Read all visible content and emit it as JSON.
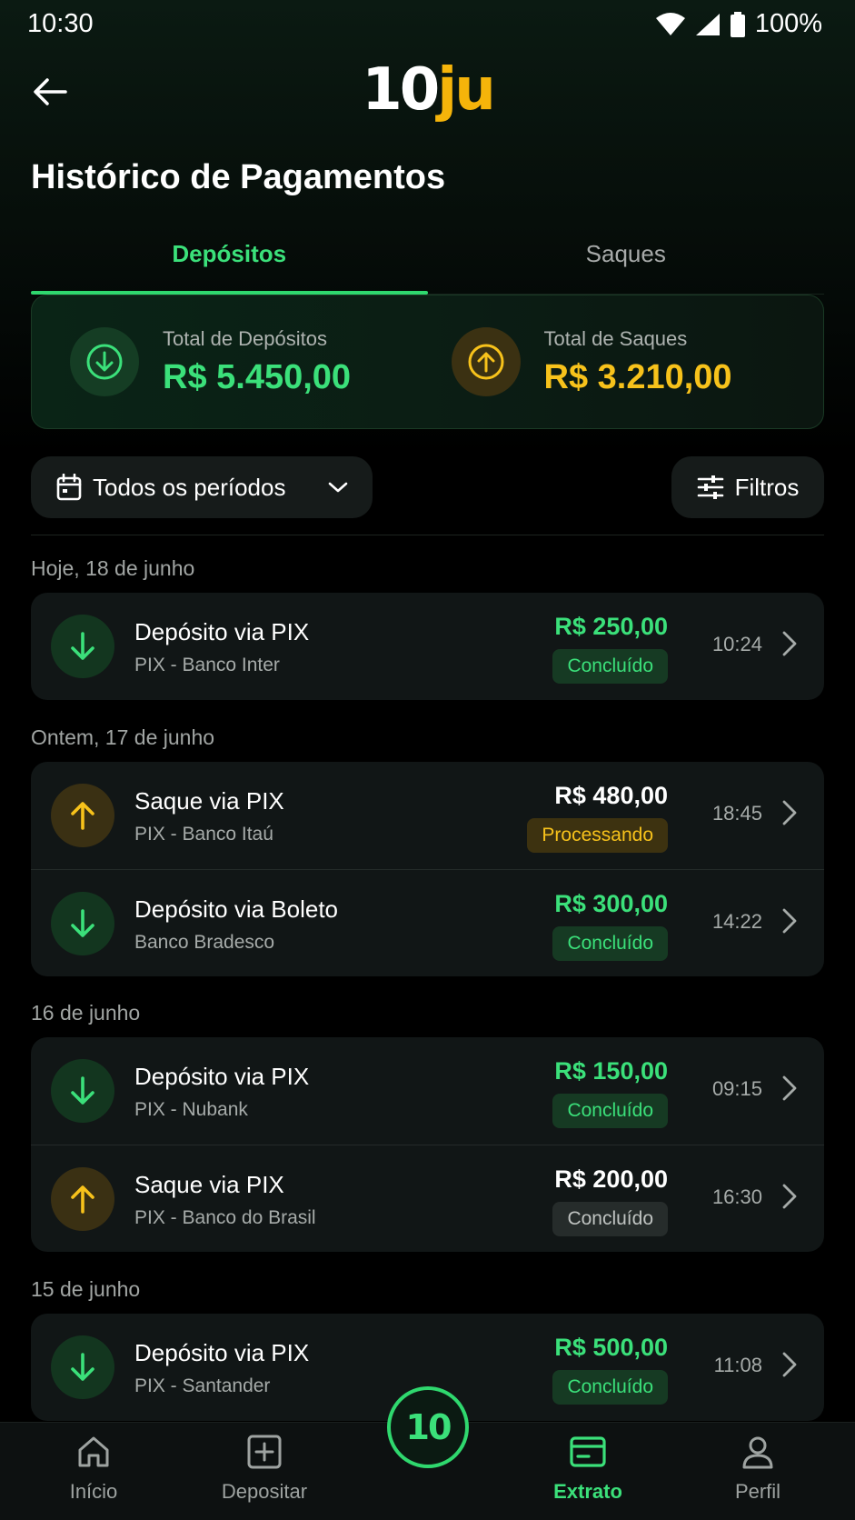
{
  "status_bar": {
    "time": "10:30",
    "battery": "100%"
  },
  "header": {
    "logo_main": "10",
    "logo_accent": "ju"
  },
  "page_title": "Histórico de Pagamentos",
  "tabs": [
    {
      "label": "Depósitos",
      "active": true
    },
    {
      "label": "Saques",
      "active": false
    }
  ],
  "summary": {
    "deposits": {
      "label": "Total de Depósitos",
      "value": "R$ 5.450,00"
    },
    "withdrawals": {
      "label": "Total de Saques",
      "value": "R$ 3.210,00"
    }
  },
  "filters": {
    "period": "Todos os períodos",
    "filters_label": "Filtros"
  },
  "groups": [
    {
      "label": "Hoje, 18 de junho",
      "items": [
        {
          "title": "Depósito via PIX",
          "subtitle": "PIX - Banco Inter",
          "amount": "R$ 250,00",
          "status": "Concluído",
          "time": "10:24",
          "kind": "deposit",
          "status_color": "green"
        }
      ]
    },
    {
      "label": "Ontem, 17 de junho",
      "items": [
        {
          "title": "Saque via PIX",
          "subtitle": "PIX - Banco Itaú",
          "amount": "R$ 480,00",
          "status": "Processando",
          "time": "18:45",
          "kind": "withdrawal",
          "status_color": "yellow"
        },
        {
          "title": "Depósito via Boleto",
          "subtitle": "Banco Bradesco",
          "amount": "R$ 300,00",
          "status": "Concluído",
          "time": "14:22",
          "kind": "deposit",
          "status_color": "green"
        }
      ]
    },
    {
      "label": "16 de junho",
      "items": [
        {
          "title": "Depósito via PIX",
          "subtitle": "PIX - Nubank",
          "amount": "R$ 150,00",
          "status": "Concluído",
          "time": "09:15",
          "kind": "deposit",
          "status_color": "green"
        },
        {
          "title": "Saque via PIX",
          "subtitle": "PIX - Banco do Brasil",
          "amount": "R$ 200,00",
          "status": "Concluído",
          "time": "16:30",
          "kind": "withdrawal",
          "status_color": "gray"
        }
      ]
    },
    {
      "label": "15 de junho",
      "items": [
        {
          "title": "Depósito via PIX",
          "subtitle": "PIX - Santander",
          "amount": "R$ 500,00",
          "status": "Concluído",
          "time": "11:08",
          "kind": "deposit",
          "status_color": "green"
        }
      ]
    }
  ],
  "bottom_nav": {
    "items": [
      {
        "label": "Início",
        "icon": "home-icon"
      },
      {
        "label": "Depositar",
        "icon": "plus-square-icon"
      },
      {
        "label": "Extrato",
        "icon": "card-icon",
        "active": true
      },
      {
        "label": "Perfil",
        "icon": "user-icon"
      }
    ],
    "center_label": "10"
  },
  "colors": {
    "accent_green": "#3be07a",
    "accent_yellow": "#f7c21b",
    "background": "#000000"
  }
}
